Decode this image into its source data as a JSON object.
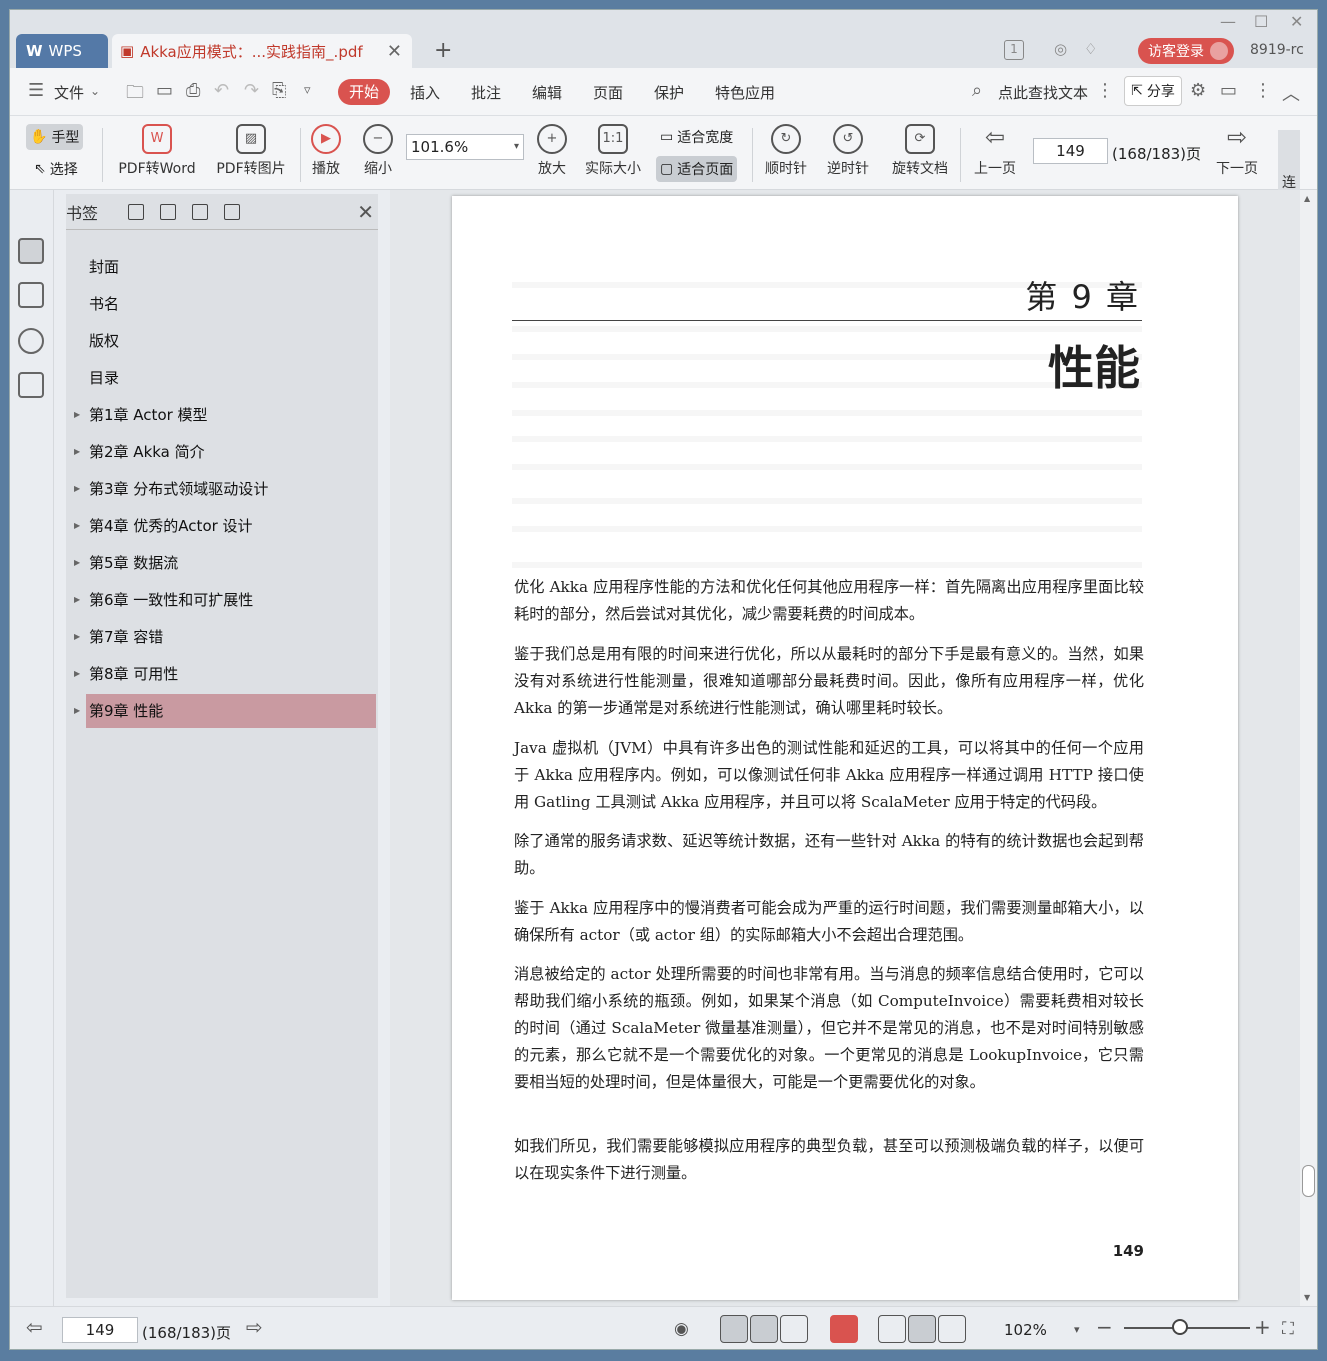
{
  "titlebar": {
    "app_tab": "WPS",
    "doc_tab": "Akka应用模式：...实践指南_.pdf",
    "login": "访客登录",
    "user": "8919-rc",
    "badge": "1"
  },
  "menu": {
    "file": "文件",
    "tabs": [
      "开始",
      "插入",
      "批注",
      "编辑",
      "页面",
      "保护",
      "特色应用"
    ],
    "search": "点此查找文本",
    "share": "分享"
  },
  "toolbar": {
    "hand": "手型",
    "select": "选择",
    "pdf2word": "PDF转Word",
    "pdf2img": "PDF转图片",
    "play": "播放",
    "zoom_out": "缩小",
    "zoom": "101.6%",
    "zoom_in": "放大",
    "actual": "实际大小",
    "fit_width": "适合宽度",
    "fit_page": "适合页面",
    "cw": "顺时针",
    "ccw": "逆时针",
    "rotate": "旋转文档",
    "prev": "上一页",
    "page": "149",
    "page_total": "(168/183)页",
    "next": "下一页",
    "cont": "连"
  },
  "bookmarks": {
    "title": "书签",
    "items": [
      {
        "label": "封面",
        "arrow": false
      },
      {
        "label": "书名",
        "arrow": false
      },
      {
        "label": "版权",
        "arrow": false
      },
      {
        "label": "目录",
        "arrow": false
      },
      {
        "label": "第1章 Actor 模型",
        "arrow": true
      },
      {
        "label": "第2章 Akka 简介",
        "arrow": true
      },
      {
        "label": "第3章 分布式领域驱动设计",
        "arrow": true
      },
      {
        "label": "第4章 优秀的Actor 设计",
        "arrow": true
      },
      {
        "label": "第5章 数据流",
        "arrow": true
      },
      {
        "label": "第6章 一致性和可扩展性",
        "arrow": true
      },
      {
        "label": "第7章 容错",
        "arrow": true
      },
      {
        "label": "第8章 可用性",
        "arrow": true
      },
      {
        "label": "第9章 性能",
        "arrow": true,
        "selected": true
      }
    ]
  },
  "document": {
    "chapter_num": "第 9 章",
    "chapter_title": "性能",
    "paragraphs": [
      "优化 Akka 应用程序性能的方法和优化任何其他应用程序一样：首先隔离出应用程序里面比较耗时的部分，然后尝试对其优化，减少需要耗费的时间成本。",
      "鉴于我们总是用有限的时间来进行优化，所以从最耗时的部分下手是最有意义的。当然，如果没有对系统进行性能测量，很难知道哪部分最耗费时间。因此，像所有应用程序一样，优化 Akka 的第一步通常是对系统进行性能测试，确认哪里耗时较长。",
      "Java 虚拟机（JVM）中具有许多出色的测试性能和延迟的工具，可以将其中的任何一个应用于 Akka 应用程序内。例如，可以像测试任何非 Akka 应用程序一样通过调用 HTTP 接口使用 Gatling 工具测试 Akka 应用程序，并且可以将 ScalaMeter 应用于特定的代码段。",
      "除了通常的服务请求数、延迟等统计数据，还有一些针对 Akka 的特有的统计数据也会起到帮助。",
      "鉴于 Akka 应用程序中的慢消费者可能会成为严重的运行时间题，我们需要测量邮箱大小，以确保所有 actor（或 actor 组）的实际邮箱大小不会超出合理范围。",
      "消息被给定的 actor 处理所需要的时间也非常有用。当与消息的频率信息结合使用时，它可以帮助我们缩小系统的瓶颈。例如，如果某个消息（如 ComputeInvoice）需要耗费相对较长的时间（通过 ScalaMeter 微量基准测量），但它并不是常见的消息，也不是对时间特别敏感的元素，那么它就不是一个需要优化的对象。一个更常见的消息是 LookupInvoice，它只需要相当短的处理时间，但是体量很大，可能是一个更需要优化的对象。",
      "如我们所见，我们需要能够模拟应用程序的典型负载，甚至可以预测极端负载的样子，以便可以在现实条件下进行测量。"
    ],
    "page_number": "149"
  },
  "status": {
    "page": "149",
    "page_total": "(168/183)页",
    "zoom": "102%"
  }
}
